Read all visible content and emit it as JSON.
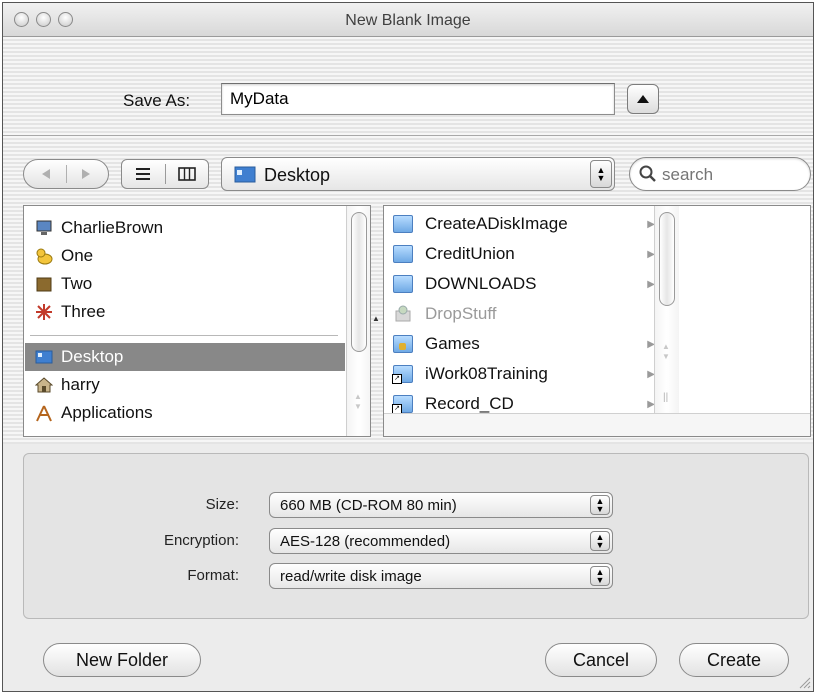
{
  "window": {
    "title": "New Blank Image"
  },
  "save_as": {
    "label": "Save As:",
    "value": "MyData"
  },
  "toolbar": {
    "location": "Desktop",
    "search_placeholder": "search"
  },
  "sidebar": {
    "items": [
      {
        "label": "CharlieBrown",
        "icon": "computer-icon"
      },
      {
        "label": "One",
        "icon": "duck-icon"
      },
      {
        "label": "Two",
        "icon": "box-icon"
      },
      {
        "label": "Three",
        "icon": "splat-icon"
      },
      {
        "label": "Desktop",
        "icon": "desktop-icon",
        "selected": true
      },
      {
        "label": "harry",
        "icon": "home-icon"
      },
      {
        "label": "Applications",
        "icon": "applications-icon"
      }
    ]
  },
  "files": {
    "items": [
      {
        "label": "CreateADiskImage",
        "icon": "folder-icon",
        "has_children": true
      },
      {
        "label": "CreditUnion",
        "icon": "folder-icon",
        "has_children": true
      },
      {
        "label": "DOWNLOADS",
        "icon": "folder-icon",
        "has_children": true
      },
      {
        "label": "DropStuff",
        "icon": "dropstuff-app-icon",
        "disabled": true
      },
      {
        "label": "Games",
        "icon": "folder-lock-icon",
        "has_children": true
      },
      {
        "label": "iWork08Training",
        "icon": "alias-folder-icon",
        "has_children": true
      },
      {
        "label": "Record_CD",
        "icon": "alias-folder-icon",
        "has_children": true
      }
    ]
  },
  "options": {
    "size_label": "Size:",
    "size_value": "660 MB (CD-ROM 80 min)",
    "encryption_label": "Encryption:",
    "encryption_value": "AES-128 (recommended)",
    "format_label": "Format:",
    "format_value": "read/write disk image"
  },
  "buttons": {
    "new_folder": "New Folder",
    "cancel": "Cancel",
    "create": "Create"
  }
}
